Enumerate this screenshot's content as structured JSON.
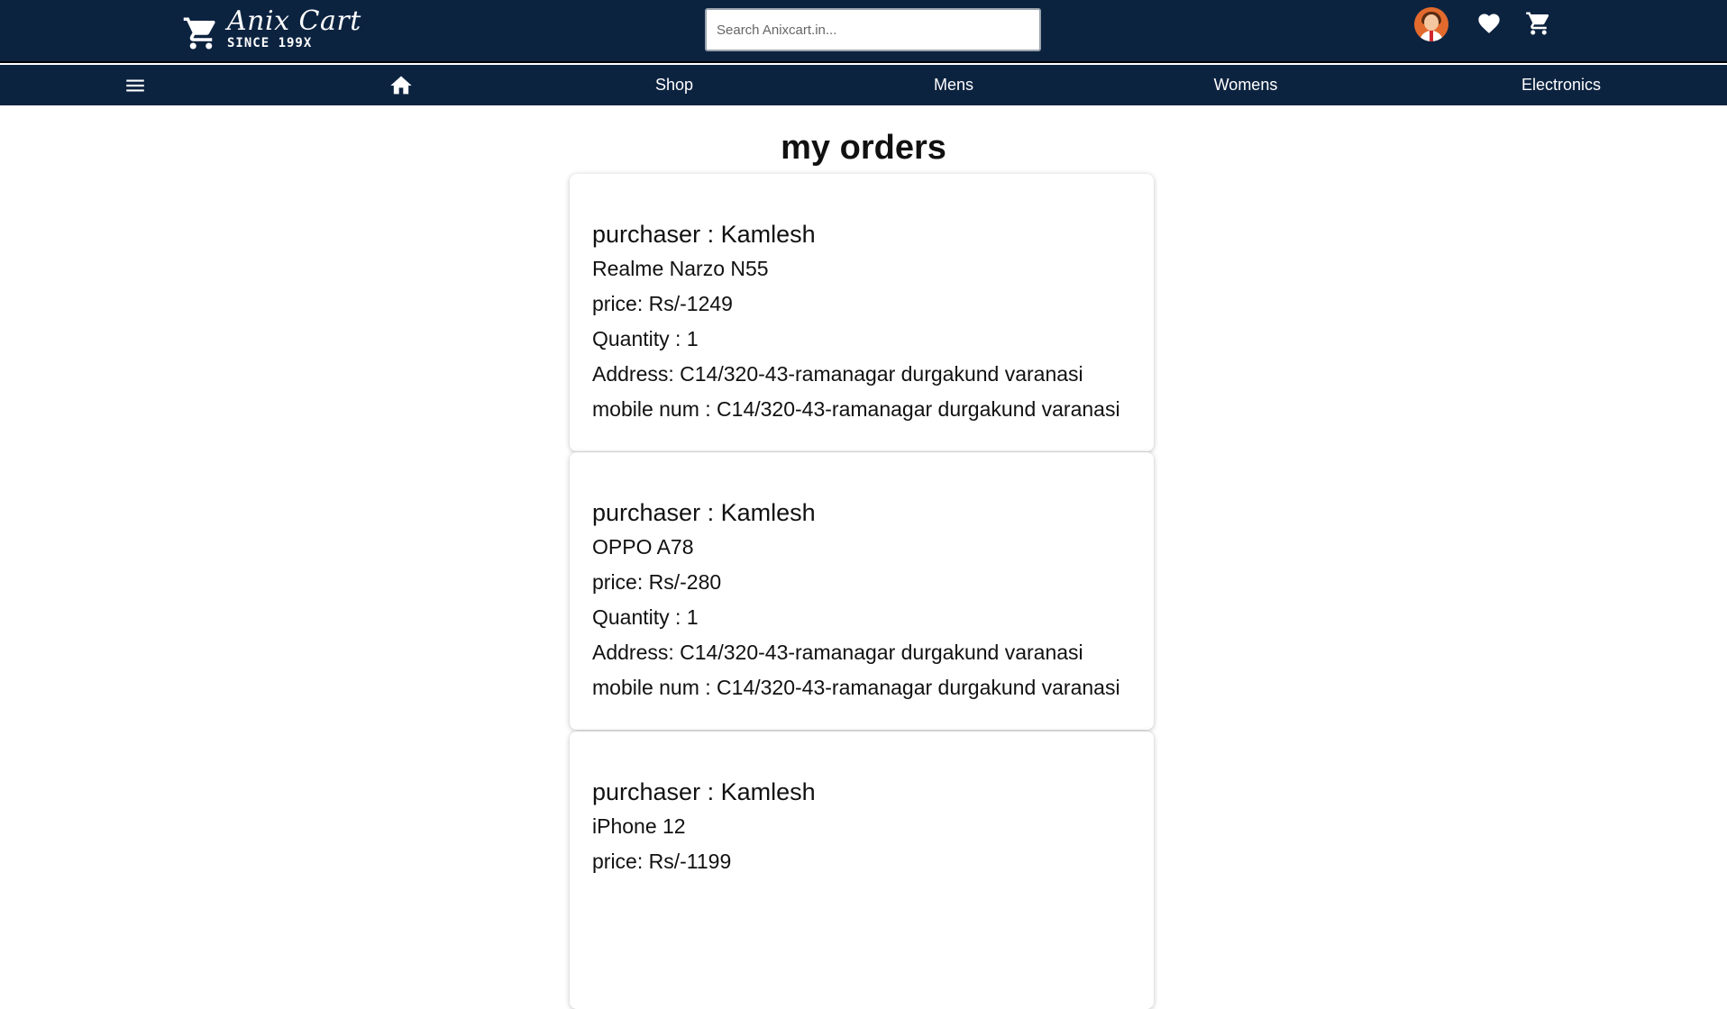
{
  "header": {
    "brand_name": "Anix Cart",
    "brand_since": "SINCE 199X",
    "search_placeholder": "Search Anixcart.in...",
    "icons": [
      "shopping-cart-logo-icon",
      "user-avatar",
      "heart-icon",
      "cart-icon"
    ]
  },
  "nav": {
    "items": [
      {
        "label": "Shop"
      },
      {
        "label": "Mens"
      },
      {
        "label": "Womens"
      },
      {
        "label": "Electronics"
      }
    ],
    "icons": [
      "menu-icon",
      "home-icon"
    ]
  },
  "page": {
    "title": "my orders"
  },
  "orders": [
    {
      "purchaser": "purchaser : Kamlesh",
      "product": "Realme Narzo N55",
      "price": "price: Rs/-1249",
      "quantity": "Quantity : 1",
      "address": "Address: C14/320-43-ramanagar durgakund varanasi",
      "mobile": "mobile num : C14/320-43-ramanagar durgakund varanasi"
    },
    {
      "purchaser": "purchaser : Kamlesh",
      "product": "OPPO A78",
      "price": "price: Rs/-280",
      "quantity": "Quantity : 1",
      "address": "Address: C14/320-43-ramanagar durgakund varanasi",
      "mobile": "mobile num : C14/320-43-ramanagar durgakund varanasi"
    },
    {
      "purchaser": "purchaser : Kamlesh",
      "product": "iPhone 12",
      "price": "price: Rs/-1199"
    }
  ],
  "colors": {
    "header_bg": "#0c2340",
    "page_bg": "#ffffff",
    "text": "#111111"
  }
}
